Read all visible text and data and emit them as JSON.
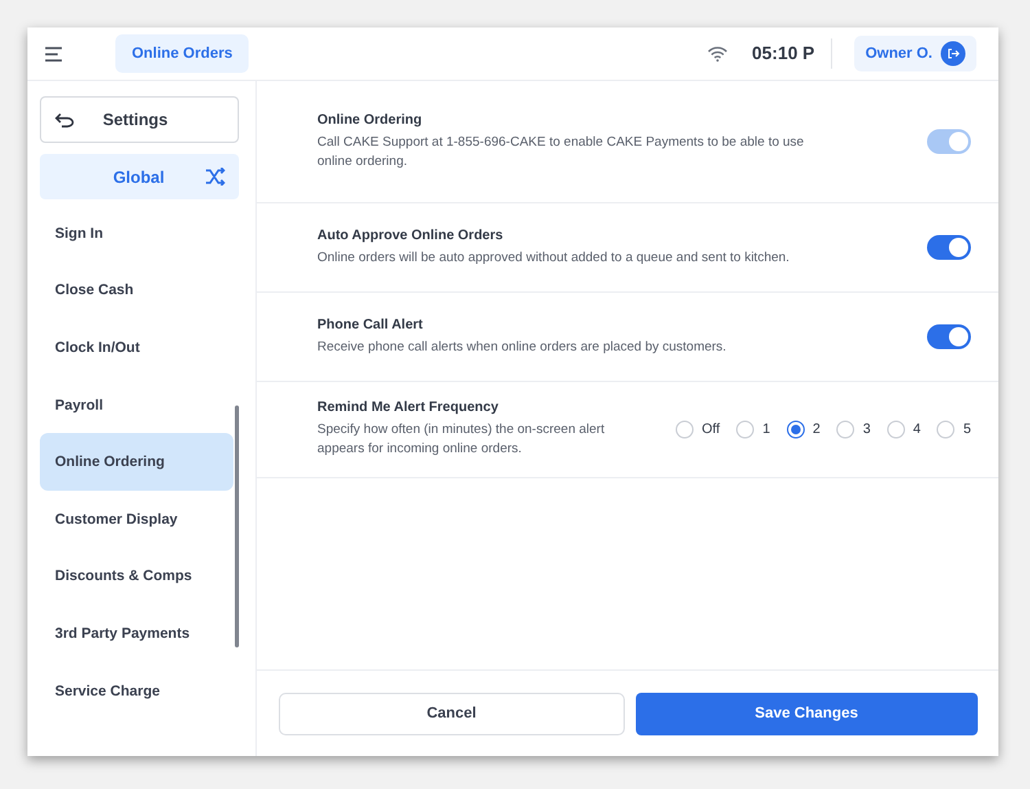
{
  "header": {
    "active_tab": "Online Orders",
    "time": "05:10 P",
    "user": "Owner O."
  },
  "sidebar": {
    "back_label": "Settings",
    "scope": "Global",
    "items": [
      {
        "label": "Sign In",
        "selected": false
      },
      {
        "label": "Close Cash",
        "selected": false
      },
      {
        "label": "Clock In/Out",
        "selected": false
      },
      {
        "label": "Payroll",
        "selected": false
      },
      {
        "label": "Online Ordering",
        "selected": true
      },
      {
        "label": "Customer Display",
        "selected": false
      },
      {
        "label": "Discounts & Comps",
        "selected": false
      },
      {
        "label": "3rd Party Payments",
        "selected": false
      },
      {
        "label": "Service Charge",
        "selected": false
      }
    ]
  },
  "settings": [
    {
      "kind": "toggle",
      "title": "Online Ordering",
      "description": "Call CAKE Support at 1-855-696-CAKE to enable CAKE Payments to be able to use online ordering.",
      "on": true,
      "disabled": true
    },
    {
      "kind": "toggle",
      "title": "Auto Approve Online Orders",
      "description": "Online orders will be auto approved without added to a queue and sent to kitchen.",
      "on": true,
      "disabled": false
    },
    {
      "kind": "toggle",
      "title": "Phone Call Alert",
      "description": "Receive phone call alerts when online orders are placed by customers.",
      "on": true,
      "disabled": false
    },
    {
      "kind": "radio",
      "title": "Remind Me Alert Frequency",
      "description": "Specify how often (in minutes) the on-screen alert appears for incoming online orders.",
      "options": [
        {
          "label": "Off",
          "selected": false
        },
        {
          "label": "1",
          "selected": false
        },
        {
          "label": "2",
          "selected": true
        },
        {
          "label": "3",
          "selected": false
        },
        {
          "label": "4",
          "selected": false
        },
        {
          "label": "5",
          "selected": false
        }
      ]
    }
  ],
  "footer": {
    "cancel": "Cancel",
    "save": "Save Changes"
  }
}
